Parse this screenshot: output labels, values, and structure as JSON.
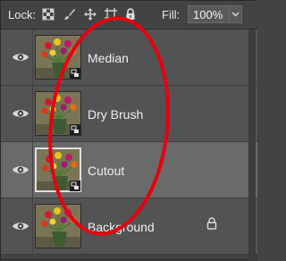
{
  "toolbar": {
    "lock_label": "Lock:",
    "fill_label": "Fill:",
    "fill_value": "100%"
  },
  "layers": [
    {
      "name": "Median",
      "selected": false,
      "smart_object": true,
      "locked": false
    },
    {
      "name": "Dry Brush",
      "selected": false,
      "smart_object": true,
      "locked": false
    },
    {
      "name": "Cutout",
      "selected": true,
      "smart_object": true,
      "locked": false
    },
    {
      "name": "Background",
      "selected": false,
      "smart_object": false,
      "locked": true
    }
  ],
  "colors": {
    "panel": "#535353",
    "selected": "#6a6a6a",
    "annotation": "#e8000e"
  },
  "icons": {
    "lock_transparent": "checkerboard-icon",
    "lock_image": "brush-icon",
    "lock_position": "move-icon",
    "lock_artboard": "artboard-icon",
    "lock_all": "padlock-icon",
    "visibility": "eye-icon",
    "dropdown": "chevron-down-icon"
  }
}
